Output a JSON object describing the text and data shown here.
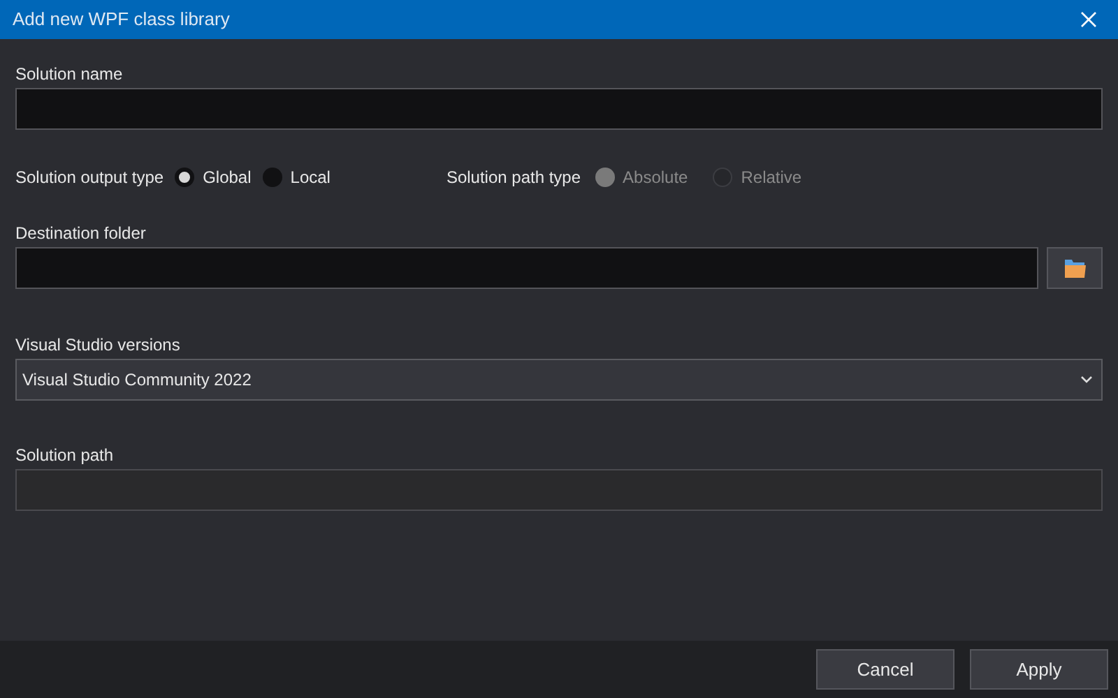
{
  "window": {
    "title": "Add new WPF class library"
  },
  "solution_name": {
    "label": "Solution name"
  },
  "output_type": {
    "label": "Solution output type",
    "options": [
      {
        "label": "Global",
        "selected": true
      },
      {
        "label": "Local",
        "selected": false
      }
    ]
  },
  "path_type": {
    "label": "Solution path type",
    "disabled": true,
    "options": [
      {
        "label": "Absolute",
        "selected": true
      },
      {
        "label": "Relative",
        "selected": false
      }
    ]
  },
  "destination_folder": {
    "label": "Destination folder"
  },
  "vs_versions": {
    "label": "Visual Studio versions",
    "value": "Visual Studio Community 2022"
  },
  "solution_path": {
    "label": "Solution path",
    "disabled": true
  },
  "buttons": [
    "Cancel",
    "Apply"
  ]
}
